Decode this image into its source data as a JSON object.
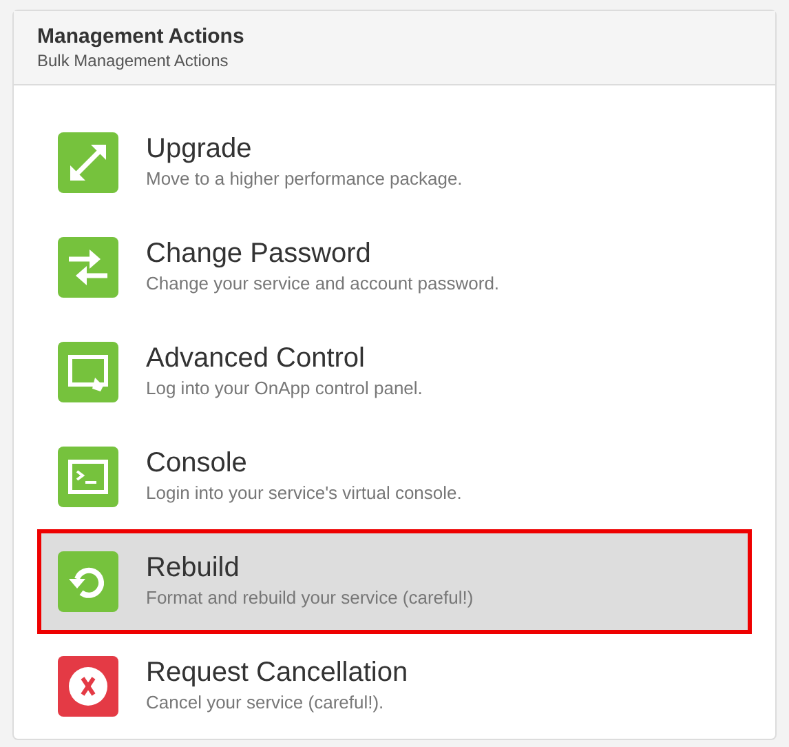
{
  "panel": {
    "title": "Management Actions",
    "subtitle": "Bulk Management Actions"
  },
  "actions": [
    {
      "kind": "upgrade",
      "title": "Upgrade",
      "description": "Move to a higher performance package.",
      "selected": false
    },
    {
      "kind": "password",
      "title": "Change Password",
      "description": "Change your service and account password.",
      "selected": false
    },
    {
      "kind": "control",
      "title": "Advanced Control",
      "description": "Log into your OnApp control panel.",
      "selected": false
    },
    {
      "kind": "console",
      "title": "Console",
      "description": "Login into your service's virtual console.",
      "selected": false
    },
    {
      "kind": "rebuild",
      "title": "Rebuild",
      "description": "Format and rebuild your service (careful!)",
      "selected": true
    },
    {
      "kind": "cancel",
      "title": "Request Cancellation",
      "description": "Cancel your service (careful!).",
      "selected": false
    }
  ]
}
